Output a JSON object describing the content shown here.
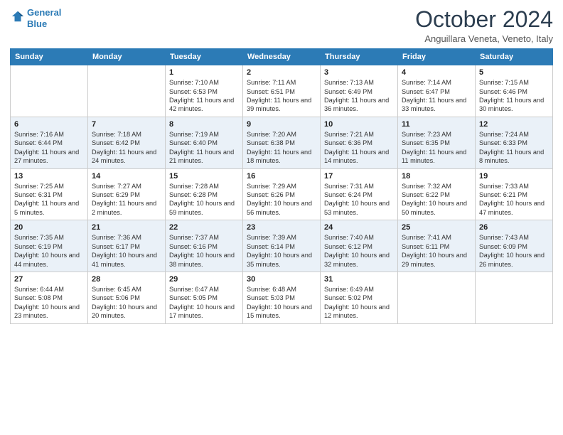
{
  "header": {
    "logo_line1": "General",
    "logo_line2": "Blue",
    "month": "October 2024",
    "location": "Anguillara Veneta, Veneto, Italy"
  },
  "days_of_week": [
    "Sunday",
    "Monday",
    "Tuesday",
    "Wednesday",
    "Thursday",
    "Friday",
    "Saturday"
  ],
  "weeks": [
    [
      {
        "day": "",
        "sunrise": "",
        "sunset": "",
        "daylight": ""
      },
      {
        "day": "",
        "sunrise": "",
        "sunset": "",
        "daylight": ""
      },
      {
        "day": "1",
        "sunrise": "Sunrise: 7:10 AM",
        "sunset": "Sunset: 6:53 PM",
        "daylight": "Daylight: 11 hours and 42 minutes."
      },
      {
        "day": "2",
        "sunrise": "Sunrise: 7:11 AM",
        "sunset": "Sunset: 6:51 PM",
        "daylight": "Daylight: 11 hours and 39 minutes."
      },
      {
        "day": "3",
        "sunrise": "Sunrise: 7:13 AM",
        "sunset": "Sunset: 6:49 PM",
        "daylight": "Daylight: 11 hours and 36 minutes."
      },
      {
        "day": "4",
        "sunrise": "Sunrise: 7:14 AM",
        "sunset": "Sunset: 6:47 PM",
        "daylight": "Daylight: 11 hours and 33 minutes."
      },
      {
        "day": "5",
        "sunrise": "Sunrise: 7:15 AM",
        "sunset": "Sunset: 6:46 PM",
        "daylight": "Daylight: 11 hours and 30 minutes."
      }
    ],
    [
      {
        "day": "6",
        "sunrise": "Sunrise: 7:16 AM",
        "sunset": "Sunset: 6:44 PM",
        "daylight": "Daylight: 11 hours and 27 minutes."
      },
      {
        "day": "7",
        "sunrise": "Sunrise: 7:18 AM",
        "sunset": "Sunset: 6:42 PM",
        "daylight": "Daylight: 11 hours and 24 minutes."
      },
      {
        "day": "8",
        "sunrise": "Sunrise: 7:19 AM",
        "sunset": "Sunset: 6:40 PM",
        "daylight": "Daylight: 11 hours and 21 minutes."
      },
      {
        "day": "9",
        "sunrise": "Sunrise: 7:20 AM",
        "sunset": "Sunset: 6:38 PM",
        "daylight": "Daylight: 11 hours and 18 minutes."
      },
      {
        "day": "10",
        "sunrise": "Sunrise: 7:21 AM",
        "sunset": "Sunset: 6:36 PM",
        "daylight": "Daylight: 11 hours and 14 minutes."
      },
      {
        "day": "11",
        "sunrise": "Sunrise: 7:23 AM",
        "sunset": "Sunset: 6:35 PM",
        "daylight": "Daylight: 11 hours and 11 minutes."
      },
      {
        "day": "12",
        "sunrise": "Sunrise: 7:24 AM",
        "sunset": "Sunset: 6:33 PM",
        "daylight": "Daylight: 11 hours and 8 minutes."
      }
    ],
    [
      {
        "day": "13",
        "sunrise": "Sunrise: 7:25 AM",
        "sunset": "Sunset: 6:31 PM",
        "daylight": "Daylight: 11 hours and 5 minutes."
      },
      {
        "day": "14",
        "sunrise": "Sunrise: 7:27 AM",
        "sunset": "Sunset: 6:29 PM",
        "daylight": "Daylight: 11 hours and 2 minutes."
      },
      {
        "day": "15",
        "sunrise": "Sunrise: 7:28 AM",
        "sunset": "Sunset: 6:28 PM",
        "daylight": "Daylight: 10 hours and 59 minutes."
      },
      {
        "day": "16",
        "sunrise": "Sunrise: 7:29 AM",
        "sunset": "Sunset: 6:26 PM",
        "daylight": "Daylight: 10 hours and 56 minutes."
      },
      {
        "day": "17",
        "sunrise": "Sunrise: 7:31 AM",
        "sunset": "Sunset: 6:24 PM",
        "daylight": "Daylight: 10 hours and 53 minutes."
      },
      {
        "day": "18",
        "sunrise": "Sunrise: 7:32 AM",
        "sunset": "Sunset: 6:22 PM",
        "daylight": "Daylight: 10 hours and 50 minutes."
      },
      {
        "day": "19",
        "sunrise": "Sunrise: 7:33 AM",
        "sunset": "Sunset: 6:21 PM",
        "daylight": "Daylight: 10 hours and 47 minutes."
      }
    ],
    [
      {
        "day": "20",
        "sunrise": "Sunrise: 7:35 AM",
        "sunset": "Sunset: 6:19 PM",
        "daylight": "Daylight: 10 hours and 44 minutes."
      },
      {
        "day": "21",
        "sunrise": "Sunrise: 7:36 AM",
        "sunset": "Sunset: 6:17 PM",
        "daylight": "Daylight: 10 hours and 41 minutes."
      },
      {
        "day": "22",
        "sunrise": "Sunrise: 7:37 AM",
        "sunset": "Sunset: 6:16 PM",
        "daylight": "Daylight: 10 hours and 38 minutes."
      },
      {
        "day": "23",
        "sunrise": "Sunrise: 7:39 AM",
        "sunset": "Sunset: 6:14 PM",
        "daylight": "Daylight: 10 hours and 35 minutes."
      },
      {
        "day": "24",
        "sunrise": "Sunrise: 7:40 AM",
        "sunset": "Sunset: 6:12 PM",
        "daylight": "Daylight: 10 hours and 32 minutes."
      },
      {
        "day": "25",
        "sunrise": "Sunrise: 7:41 AM",
        "sunset": "Sunset: 6:11 PM",
        "daylight": "Daylight: 10 hours and 29 minutes."
      },
      {
        "day": "26",
        "sunrise": "Sunrise: 7:43 AM",
        "sunset": "Sunset: 6:09 PM",
        "daylight": "Daylight: 10 hours and 26 minutes."
      }
    ],
    [
      {
        "day": "27",
        "sunrise": "Sunrise: 6:44 AM",
        "sunset": "Sunset: 5:08 PM",
        "daylight": "Daylight: 10 hours and 23 minutes."
      },
      {
        "day": "28",
        "sunrise": "Sunrise: 6:45 AM",
        "sunset": "Sunset: 5:06 PM",
        "daylight": "Daylight: 10 hours and 20 minutes."
      },
      {
        "day": "29",
        "sunrise": "Sunrise: 6:47 AM",
        "sunset": "Sunset: 5:05 PM",
        "daylight": "Daylight: 10 hours and 17 minutes."
      },
      {
        "day": "30",
        "sunrise": "Sunrise: 6:48 AM",
        "sunset": "Sunset: 5:03 PM",
        "daylight": "Daylight: 10 hours and 15 minutes."
      },
      {
        "day": "31",
        "sunrise": "Sunrise: 6:49 AM",
        "sunset": "Sunset: 5:02 PM",
        "daylight": "Daylight: 10 hours and 12 minutes."
      },
      {
        "day": "",
        "sunrise": "",
        "sunset": "",
        "daylight": ""
      },
      {
        "day": "",
        "sunrise": "",
        "sunset": "",
        "daylight": ""
      }
    ]
  ]
}
